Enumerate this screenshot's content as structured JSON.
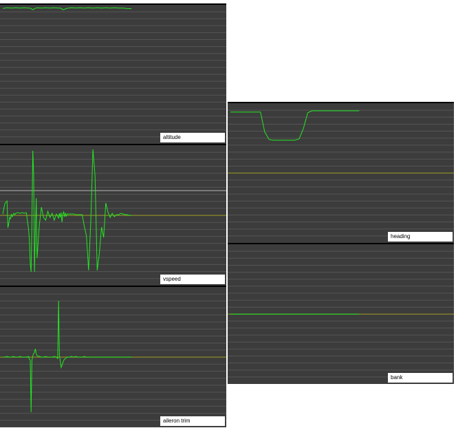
{
  "colors": {
    "panel_bg": "#3c3c3c",
    "grid": "#555555",
    "series": "#22e822",
    "zero_line": "#8c8c28",
    "ref_line": "#a0a0a0"
  },
  "chart_data": [
    {
      "type": "line",
      "title": "altitude",
      "ylim": [
        0,
        100
      ],
      "grid": true,
      "zero": null,
      "ref": null,
      "x": [
        0,
        10,
        20,
        30,
        40,
        50,
        60,
        65,
        70,
        75,
        80,
        90,
        100,
        110,
        120,
        130,
        135,
        140,
        150,
        160,
        170,
        180,
        190,
        200,
        210,
        220,
        230,
        240,
        250,
        260,
        270,
        280,
        290,
        300
      ],
      "values": [
        98.4,
        98.9,
        98.6,
        98.9,
        98.6,
        98.9,
        98.6,
        98.5,
        97.3,
        98.4,
        98.8,
        98.6,
        98.9,
        98.6,
        98.9,
        98.6,
        98.6,
        97.3,
        98.5,
        98.9,
        98.7,
        98.9,
        98.6,
        98.9,
        98.6,
        98.9,
        98.6,
        98.9,
        98.6,
        98.9,
        98.6,
        98.6,
        98.3,
        98.2
      ]
    },
    {
      "type": "line",
      "title": "vspeed",
      "ylim": [
        -100,
        100
      ],
      "grid": true,
      "zero": 0,
      "ref": 18,
      "x": [
        0,
        5,
        10,
        12,
        14,
        16,
        18,
        20,
        22,
        24,
        26,
        28,
        30,
        35,
        40,
        45,
        50,
        55,
        60,
        62,
        64,
        66,
        68,
        70,
        72,
        74,
        76,
        78,
        80,
        85,
        90,
        95,
        100,
        105,
        110,
        115,
        120,
        125,
        130,
        132,
        134,
        136,
        138,
        140,
        142,
        144,
        146,
        148,
        150,
        155,
        160,
        165,
        170,
        175,
        180,
        185,
        190,
        195,
        200,
        205,
        210,
        215,
        220,
        225,
        230,
        235,
        240,
        245,
        250,
        255,
        260,
        265,
        270,
        275,
        280,
        285,
        290,
        295,
        300
      ],
      "values": [
        2,
        17,
        21,
        -18,
        -12,
        -3,
        -5,
        2,
        -2,
        1,
        3,
        1,
        3,
        4,
        3,
        4,
        3,
        4,
        -20,
        -35,
        -70,
        -82,
        -10,
        94,
        60,
        -82,
        -22,
        25,
        -62,
        -15,
        12,
        -3,
        -7,
        6,
        -3,
        3,
        -7,
        2,
        -4,
        3,
        -3,
        4,
        -10,
        2,
        5,
        -2,
        3,
        -1,
        2,
        2,
        2,
        2,
        1,
        1,
        1,
        1,
        -16,
        -30,
        -80,
        -9,
        96,
        57,
        -80,
        -55,
        -17,
        -32,
        18,
        5,
        -3,
        3,
        -2,
        1,
        1,
        3,
        2,
        1,
        1,
        0,
        0
      ]
    },
    {
      "type": "line",
      "title": "aileron trim",
      "ylim": [
        -100,
        100
      ],
      "grid": true,
      "zero": 0,
      "ref": null,
      "x": [
        0,
        5,
        10,
        15,
        20,
        25,
        30,
        35,
        40,
        45,
        50,
        55,
        60,
        62,
        64,
        66,
        68,
        70,
        72,
        74,
        76,
        78,
        80,
        85,
        90,
        95,
        100,
        105,
        110,
        115,
        120,
        125,
        128,
        130,
        132,
        134,
        136,
        138,
        140,
        142,
        144,
        146,
        148,
        150,
        155,
        160,
        165,
        170,
        175,
        180,
        185,
        190,
        195,
        200,
        205,
        210,
        215,
        220,
        225,
        230,
        235,
        240,
        245,
        250,
        255,
        260,
        265,
        270,
        275,
        280,
        285,
        290,
        295,
        300
      ],
      "values": [
        0,
        0,
        1,
        0,
        0,
        1,
        0,
        0,
        1,
        0,
        0,
        0,
        1,
        -3,
        -4,
        -80,
        -5,
        2,
        5,
        7,
        12,
        5,
        2,
        1,
        0,
        0,
        1,
        0,
        0,
        0,
        1,
        0,
        -2,
        82,
        2,
        -5,
        -15,
        -12,
        -8,
        -5,
        -3,
        -2,
        -1,
        0,
        0,
        1,
        0,
        1,
        0,
        0,
        0,
        1,
        0,
        0,
        0,
        0,
        0,
        0,
        0,
        0,
        0,
        0,
        0,
        0,
        0,
        0,
        0,
        0,
        0,
        0,
        0,
        0,
        0,
        0
      ]
    },
    {
      "type": "line",
      "title": "heading",
      "ylim": [
        -100,
        100
      ],
      "grid": true,
      "zero": 0,
      "ref": null,
      "x": [
        0,
        10,
        20,
        30,
        40,
        50,
        60,
        70,
        80,
        90,
        100,
        110,
        120,
        130,
        140,
        150,
        160,
        170,
        180,
        190,
        200,
        210,
        220,
        230,
        240,
        250,
        260,
        270,
        280,
        290,
        300
      ],
      "values": [
        89,
        89,
        89,
        89,
        89,
        89,
        89,
        89,
        60,
        49,
        48,
        48,
        48,
        48,
        48,
        48,
        50,
        65,
        88,
        91,
        91,
        91,
        91,
        91,
        91,
        91,
        91,
        91,
        91,
        91,
        91
      ]
    },
    {
      "type": "line",
      "title": "bank",
      "ylim": [
        -100,
        100
      ],
      "grid": true,
      "zero": 0,
      "ref": null,
      "x": [
        0,
        10,
        20,
        30,
        40,
        50,
        60,
        70,
        80,
        90,
        100,
        105,
        110,
        115,
        120,
        125,
        130,
        135,
        140,
        145,
        150,
        160,
        170,
        180,
        190,
        200,
        210,
        220,
        230,
        240,
        250,
        260,
        270,
        280,
        290,
        300
      ],
      "values": [
        0,
        0,
        0,
        0,
        0,
        0,
        0,
        0,
        0,
        0,
        0,
        0,
        0,
        0,
        0,
        0,
        0,
        0,
        0,
        0,
        0,
        0,
        0,
        0,
        0,
        0,
        0,
        0,
        0,
        0,
        0,
        0,
        0,
        0,
        0,
        0
      ]
    }
  ]
}
